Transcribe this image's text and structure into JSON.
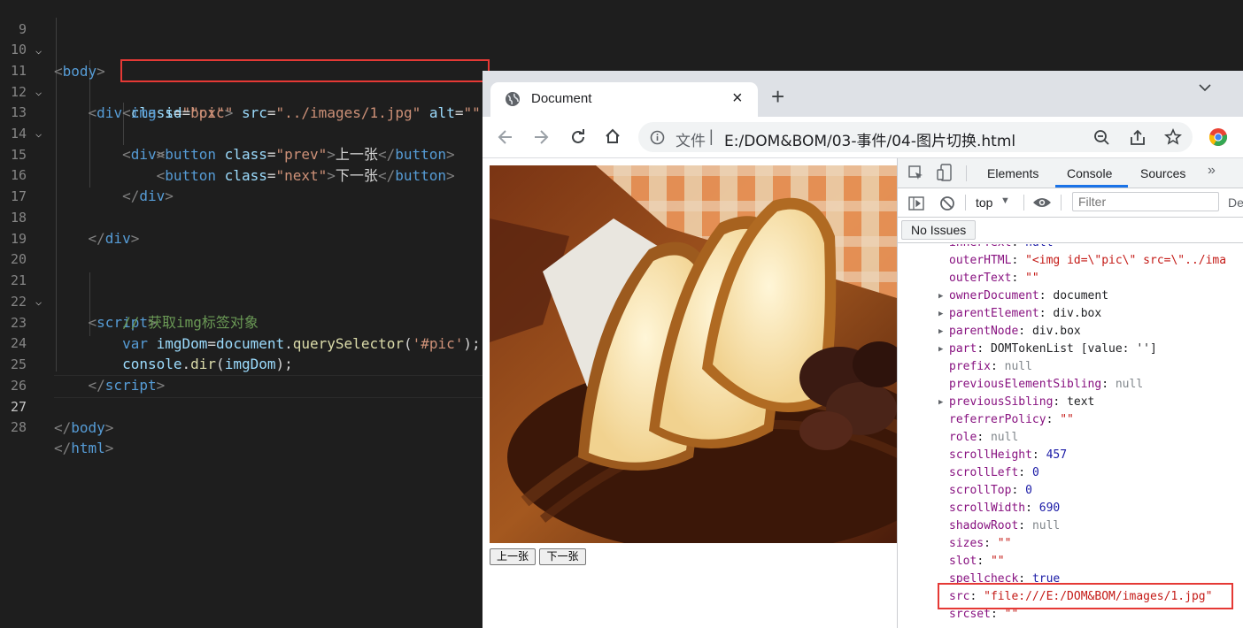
{
  "editor": {
    "lines": [
      {
        "n": "9"
      },
      {
        "n": "10"
      },
      {
        "n": "11"
      },
      {
        "n": "12"
      },
      {
        "n": "13"
      },
      {
        "n": "14"
      },
      {
        "n": "15"
      },
      {
        "n": "16"
      },
      {
        "n": "17"
      },
      {
        "n": "18"
      },
      {
        "n": "19"
      },
      {
        "n": "20"
      },
      {
        "n": "21"
      },
      {
        "n": "22"
      },
      {
        "n": "23"
      },
      {
        "n": "24"
      },
      {
        "n": "25"
      },
      {
        "n": "26"
      },
      {
        "n": "27"
      },
      {
        "n": "28"
      }
    ],
    "code": {
      "l9_tag": "body",
      "l11_tag": "div",
      "l11_attr": "class",
      "l11_val": "\"box\"",
      "l12_tag": "img",
      "l12_a1": "id",
      "l12_v1": "\"pic\"",
      "l12_a2": "src",
      "l12_v2": "\"../images/1.jpg\"",
      "l12_a3": "alt",
      "l12_v3": "\"\"",
      "l13_tag": "div",
      "l14_tag": "button",
      "l14_attr": "class",
      "l14_val": "\"prev\"",
      "l14_text": "上一张",
      "l15_tag": "button",
      "l15_attr": "class",
      "l15_val": "\"next\"",
      "l15_text": "下一张",
      "l16_tag": "div",
      "l18_tag": "div",
      "l21_tag": "script",
      "l22_comment": "// 获取img标签对象",
      "l23_kw": "var",
      "l23_var": "imgDom",
      "l23_obj": "document",
      "l23_fn": "querySelector",
      "l23_arg": "'#pic'",
      "l24_obj": "console",
      "l24_fn": "dir",
      "l24_arg": "imgDom",
      "l25_tag": "script",
      "l27_tag": "body",
      "l28_tag": "html"
    }
  },
  "browser": {
    "tab_title": "Document",
    "new_tab": "+",
    "close_tab": "×",
    "address_prefix": "文件",
    "address_url": "E:/DOM&BOM/03-事件/04-图片切换.html",
    "buttons": {
      "prev": "上一张",
      "next": "下一张"
    }
  },
  "devtools": {
    "tabs": [
      "Elements",
      "Console",
      "Sources"
    ],
    "active_tab": "Console",
    "context": "top",
    "filter_placeholder": "Filter",
    "cut_label": "De",
    "no_issues": "No Issues",
    "props": [
      {
        "k": "innerText",
        "v": "null",
        "t": "n",
        "cut": true
      },
      {
        "k": "outerHTML",
        "v": "\"<img id=\\\"pic\\\" src=\\\"../ima",
        "t": "s"
      },
      {
        "k": "outerText",
        "v": "\"\"",
        "t": "s"
      },
      {
        "k": "ownerDocument",
        "v": "document",
        "t": "p",
        "arrow": true
      },
      {
        "k": "parentElement",
        "v": "div.box",
        "t": "p",
        "arrow": true
      },
      {
        "k": "parentNode",
        "v": "div.box",
        "t": "p",
        "arrow": true
      },
      {
        "k": "part",
        "v": "DOMTokenList [value: '']",
        "t": "p",
        "arrow": true
      },
      {
        "k": "prefix",
        "v": "null",
        "t": "g"
      },
      {
        "k": "previousElementSibling",
        "v": "null",
        "t": "g"
      },
      {
        "k": "previousSibling",
        "v": "text",
        "t": "p",
        "arrow": true
      },
      {
        "k": "referrerPolicy",
        "v": "\"\"",
        "t": "s"
      },
      {
        "k": "role",
        "v": "null",
        "t": "g"
      },
      {
        "k": "scrollHeight",
        "v": "457",
        "t": "n"
      },
      {
        "k": "scrollLeft",
        "v": "0",
        "t": "n"
      },
      {
        "k": "scrollTop",
        "v": "0",
        "t": "n"
      },
      {
        "k": "scrollWidth",
        "v": "690",
        "t": "n"
      },
      {
        "k": "shadowRoot",
        "v": "null",
        "t": "g"
      },
      {
        "k": "sizes",
        "v": "\"\"",
        "t": "s"
      },
      {
        "k": "slot",
        "v": "\"\"",
        "t": "s"
      },
      {
        "k": "spellcheck",
        "v": "true",
        "t": "n"
      },
      {
        "k": "src",
        "v": "\"file:///E:/DOM&BOM/images/1.jpg\"",
        "t": "s"
      },
      {
        "k": "srcset",
        "v": "\"\"",
        "t": "s"
      }
    ]
  },
  "colors": {
    "highlight_red": "#e53935",
    "chrome_blue": "#1a73e8"
  }
}
